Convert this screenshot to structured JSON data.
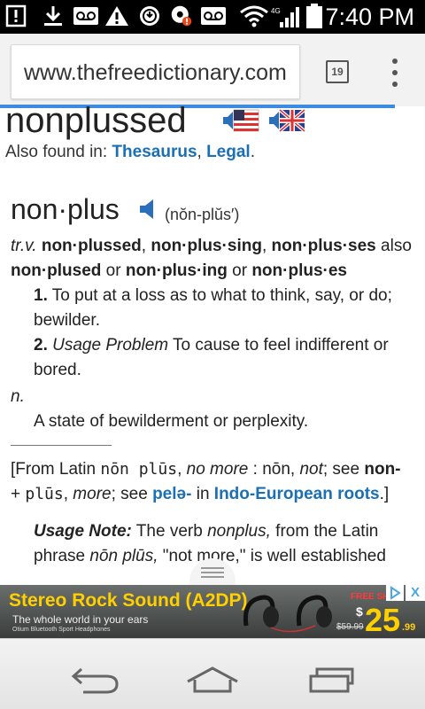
{
  "status_bar": {
    "time": "7:40 PM",
    "icons": [
      "notification-icon",
      "download-icon",
      "voicemail-icon",
      "warning-icon",
      "sync-icon",
      "app-icon",
      "voicemail-icon",
      "wifi-icon",
      "signal-icon",
      "battery-icon"
    ]
  },
  "browser": {
    "url": "www.thefreedictionary.com",
    "tab_count": "19"
  },
  "article": {
    "headword": "nonplussed",
    "also_found_label": "Also found in: ",
    "also_found_links": [
      "Thesaurus",
      "Legal"
    ],
    "entry_word": "non·plus",
    "pronunciation": "(nŏn-plŭs′)",
    "pos_tv": "tr.v.",
    "forms_1": "non·plussed",
    "forms_2": "non·plus·sing",
    "forms_3": "non·plus·ses",
    "also": " also",
    "forms_4": "non·plused",
    "or1": " or ",
    "forms_5": "non·plus·ing",
    "or2": " or ",
    "forms_6": "non·plus·es",
    "def1_num": "1.",
    "def1_text": " To put at a loss as to what to think, say, or do;",
    "def1_cont": "bewilder.",
    "def2_num": "2.",
    "def2_label": " Usage Problem",
    "def2_text": " To cause to feel indifferent or",
    "def2_cont": "bored.",
    "pos_n": "n.",
    "noun_def": "A state of bewilderment or perplexity.",
    "etym_1": "[From Latin ",
    "etym_nonplus": "nōn plūs",
    "etym_2": ", ",
    "etym_nomore": "no more",
    "etym_3": " : ",
    "etym_non": "nōn",
    "etym_4": ", ",
    "etym_not": "not",
    "etym_5": "; see ",
    "etym_nonlink": "non-",
    "etym_6": "+ ",
    "etym_plus": "plūs",
    "etym_7": ", ",
    "etym_more": "more",
    "etym_8": "; see ",
    "etym_pele": "pelə-",
    "etym_9": " in ",
    "etym_roots": "Indo-European roots",
    "etym_10": ".]",
    "usage_label": "Usage Note:",
    "usage_1": " The verb ",
    "usage_nonplus": "nonplus,",
    "usage_2": " from the Latin",
    "usage_3": "phrase ",
    "usage_nonplus_latin": "nōn plūs,",
    "usage_4": " \"not more,\" is well established"
  },
  "ad": {
    "title": "Stereo Rock Sound (A2DP)",
    "subtitle": "The whole world in your ears",
    "small_text": "Otium Bluetooth Sport Headphones",
    "free_ship": "FREE SH",
    "old_price": "$59.99",
    "dollar": "$",
    "price": "25",
    "cents": ".99",
    "close": "X"
  },
  "colors": {
    "link": "#1a6fb5",
    "progress": "#3d8be0",
    "ad_accent": "#ffd000"
  }
}
